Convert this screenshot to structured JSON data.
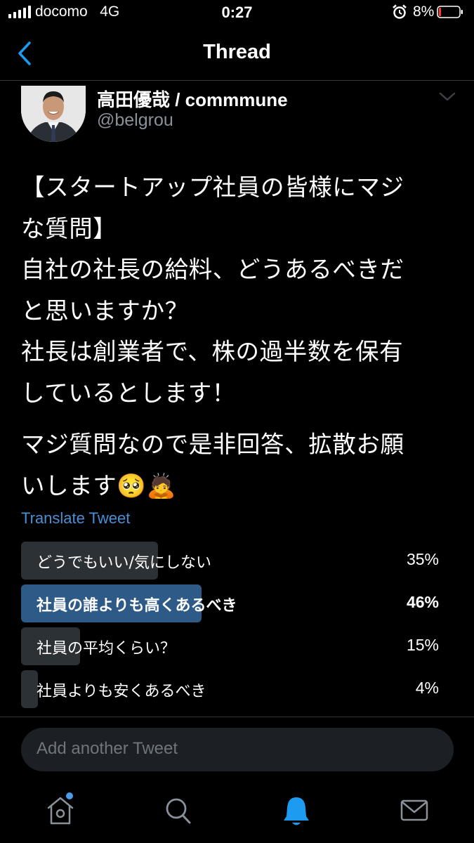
{
  "status_bar": {
    "carrier": "docomo",
    "network": "4G",
    "time": "0:27",
    "battery": "8%"
  },
  "nav": {
    "title": "Thread"
  },
  "tweet": {
    "display_name": "高田優哉 / commmune",
    "handle": "@belgrou",
    "lines": [
      "【スタートアップ社員の皆様にマジ",
      "な質問】",
      "自社の社長の給料、どうあるべきだ",
      "と思いますか？",
      "社長は創業者で、株の過半数を保有",
      "しているとします！"
    ],
    "lines2": [
      "マジ質問なので是非回答、拡散お願",
      "いします🥺🙇"
    ],
    "translate_label": "Translate Tweet"
  },
  "poll": {
    "options": [
      {
        "label": "どうでもいい/気にしない",
        "percent": "35%",
        "value": 35
      },
      {
        "label": "社員の誰よりも高くあるべき",
        "percent": "46%",
        "value": 46,
        "winner": true
      },
      {
        "label": "社員の平均くらい？",
        "percent": "15%",
        "value": 15
      },
      {
        "label": "社員よりも安くあるべき",
        "percent": "4%",
        "value": 4
      }
    ]
  },
  "compose": {
    "placeholder": "Add another Tweet"
  },
  "tabs": [
    {
      "icon": "home-icon"
    },
    {
      "icon": "search-icon"
    },
    {
      "icon": "notifications-icon",
      "active": true
    },
    {
      "icon": "messages-icon"
    }
  ],
  "colors": {
    "accent": "#1d9bf0",
    "poll_winner": "#2e5a87",
    "poll_bar": "#2c3136",
    "muted": "#8a9199"
  }
}
